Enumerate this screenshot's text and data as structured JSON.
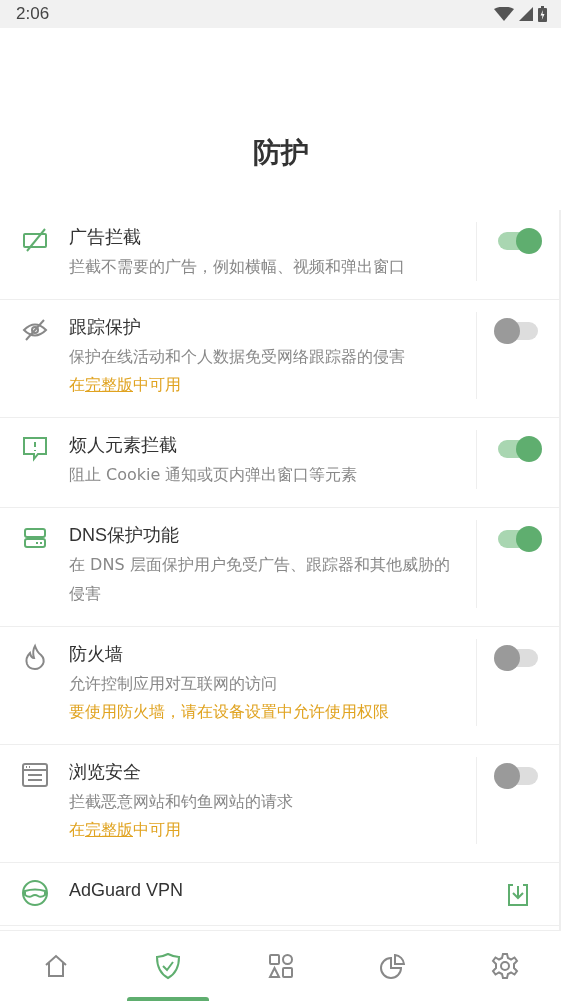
{
  "status_bar": {
    "time": "2:06"
  },
  "title": "防护",
  "items": [
    {
      "title": "广告拦截",
      "description": "拦截不需要的广告，例如横幅、视频和弹出窗口",
      "kind": "toggle",
      "on": true
    },
    {
      "title": "跟踪保护",
      "description": "保护在线活动和个人数据免受网络跟踪器的侵害",
      "note": {
        "kind": "upsell",
        "before": "在",
        "link": "完整版",
        "after": "中可用"
      },
      "kind": "toggle",
      "on": false
    },
    {
      "title": "烦人元素拦截",
      "description": "阻止 Cookie 通知或页内弹出窗口等元素",
      "kind": "toggle",
      "on": true
    },
    {
      "title": "DNS保护功能",
      "description": "在 DNS 层面保护用户免受广告、跟踪器和其他威胁的侵害",
      "kind": "toggle",
      "on": true
    },
    {
      "title": "防火墙",
      "description": "允许控制应用对互联网的访问",
      "note": {
        "kind": "warning",
        "text": "要使用防火墙，请在设备设置中允许使用权限"
      },
      "kind": "toggle",
      "on": false
    },
    {
      "title": "浏览安全",
      "description": "拦截恶意网站和钓鱼网站的请求",
      "note": {
        "kind": "upsell",
        "before": "在",
        "link": "完整版",
        "after": "中可用"
      },
      "kind": "toggle",
      "on": false
    },
    {
      "title": "AdGuard VPN",
      "kind": "download"
    }
  ],
  "nav": [
    {
      "selected": false
    },
    {
      "selected": true
    },
    {
      "selected": false
    },
    {
      "selected": false
    },
    {
      "selected": false
    }
  ]
}
